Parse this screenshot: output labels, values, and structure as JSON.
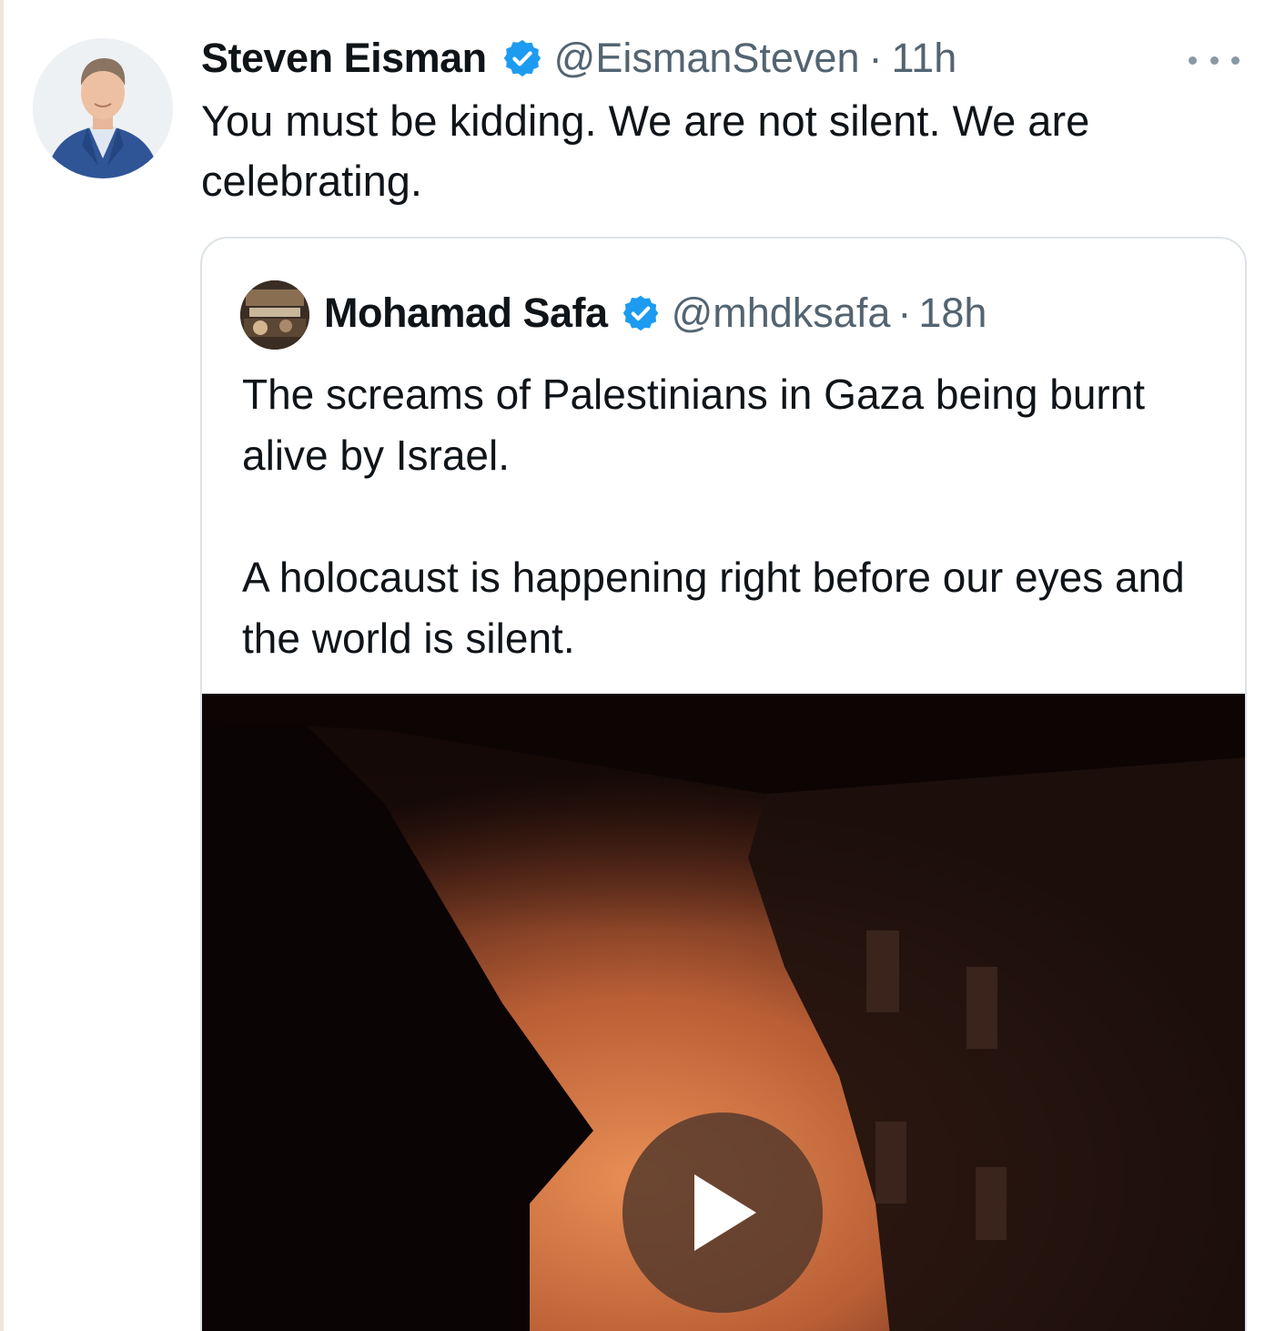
{
  "tweet": {
    "author": {
      "display_name": "Steven Eisman",
      "handle": "@EismanSteven",
      "verified": true,
      "avatar_icon": "person-in-suit-avatar"
    },
    "separator": "·",
    "time": "11h",
    "more_icon": "more-horizontal-icon",
    "text": "You must be kidding.  We are not silent. We are celebrating."
  },
  "quoted_tweet": {
    "author": {
      "display_name": "Mohamad Safa",
      "handle": "@mhdksafa",
      "verified": true,
      "avatar_icon": "profile-photo-avatar"
    },
    "separator": "·",
    "time": "18h",
    "paragraphs": [
      "The screams of Palestinians in Gaza being burnt alive by Israel.",
      "A holocaust is happening right before our eyes and the world is silent."
    ],
    "media": {
      "type": "video",
      "play_icon": "play-icon"
    }
  },
  "colors": {
    "text_primary": "#0f1419",
    "text_secondary": "#536471",
    "verified_blue": "#1d9bf0",
    "card_border": "#dde3e8"
  }
}
